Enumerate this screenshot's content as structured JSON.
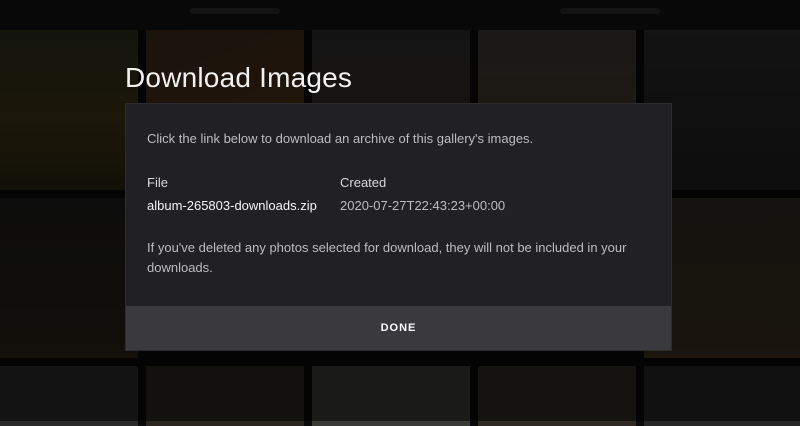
{
  "dialog": {
    "title": "Download Images",
    "intro": "Click the link below to download an archive of this gallery's images.",
    "columns": {
      "file": "File",
      "created": "Created"
    },
    "file_name": "album-265803-downloads.zip",
    "created_at": "2020-07-27T22:43:23+00:00",
    "note": "If you've deleted any photos selected for download, they will not be included in your downloads.",
    "done_label": "DONE"
  },
  "colors": {
    "dialog_bg": "#212123",
    "button_bg": "#3a3a3c",
    "text_primary": "#f5f5f5",
    "text_secondary": "#bdbdbd"
  }
}
